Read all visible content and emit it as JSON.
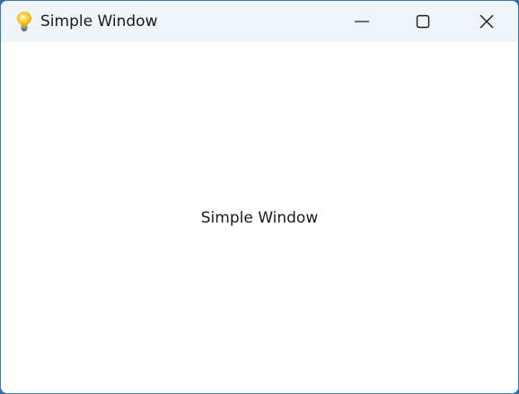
{
  "window": {
    "title": "Simple Window",
    "icon": "lightbulb-icon",
    "controls": {
      "minimize": "minimize-icon",
      "maximize": "maximize-icon",
      "close": "close-icon"
    }
  },
  "content": {
    "label": "Simple Window"
  },
  "colors": {
    "titlebar_bg": "#eff4f8",
    "window_bg": "#ffffff",
    "frame": "#3a7ab3",
    "bulb": "#f5c518"
  }
}
